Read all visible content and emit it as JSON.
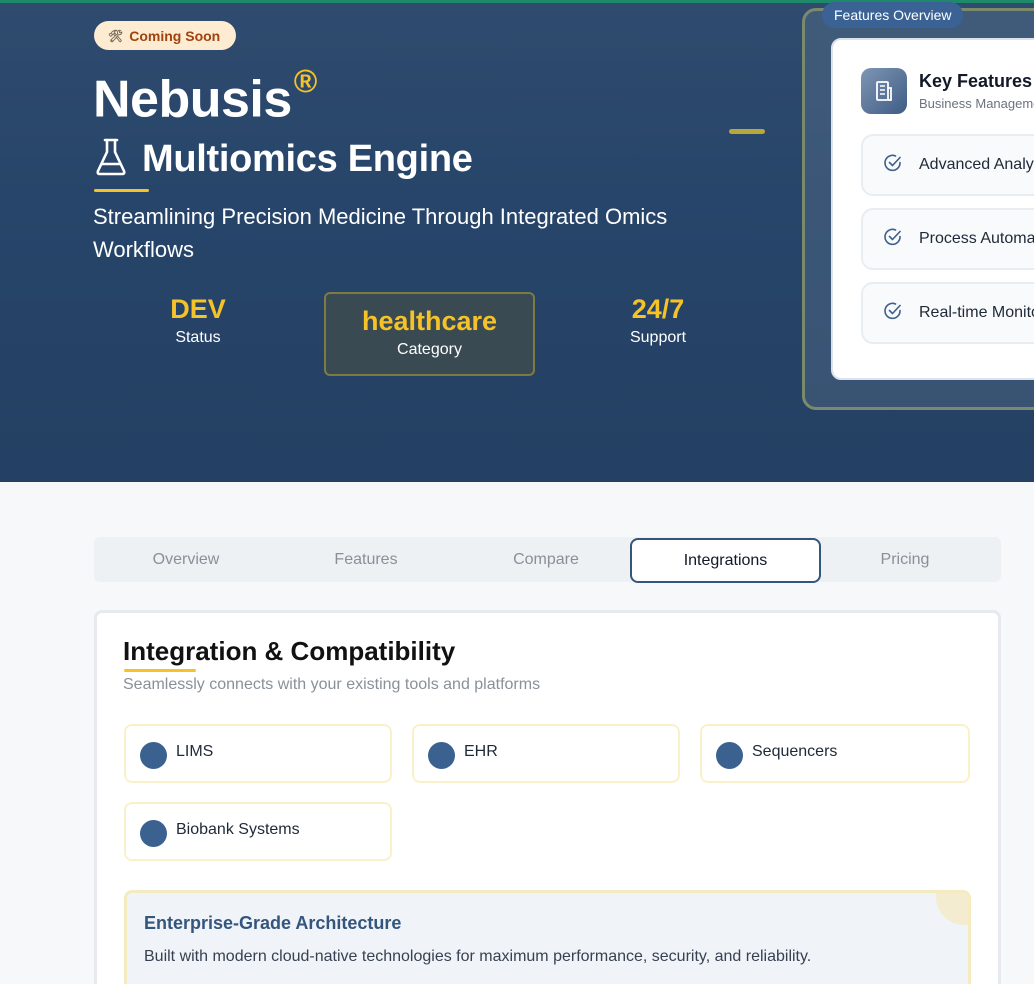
{
  "hero": {
    "badge_icon": "tools-icon",
    "badge": "Coming Soon",
    "title": "Nebusis",
    "title_mark": "®",
    "subtitle_title": "Multiomics Engine",
    "tagline": "Streamlining Precision Medicine Through Integrated Omics Workflows",
    "stats": {
      "status": {
        "value": "DEV",
        "label": "Status"
      },
      "category": {
        "value": "healthcare",
        "label": "Category"
      },
      "support": {
        "value": "24/7",
        "label": "Support"
      }
    }
  },
  "features_overview": {
    "tag": "Features Overview",
    "title": "Key Features",
    "subtitle": "Business Management",
    "items": [
      {
        "label": "Advanced Analytics"
      },
      {
        "label": "Process Automation"
      },
      {
        "label": "Real-time Monitoring"
      }
    ]
  },
  "tabs": [
    {
      "label": "Overview",
      "active": false
    },
    {
      "label": "Features",
      "active": false
    },
    {
      "label": "Compare",
      "active": false
    },
    {
      "label": "Integrations",
      "active": true
    },
    {
      "label": "Pricing",
      "active": false
    }
  ],
  "integrations": {
    "title": "Integration & Compatibility",
    "subtitle": "Seamlessly connects with your existing tools and platforms",
    "items": [
      {
        "name": "LIMS"
      },
      {
        "name": "EHR"
      },
      {
        "name": "Sequencers"
      },
      {
        "name": "Biobank Systems"
      }
    ],
    "enterprise": {
      "title": "Enterprise-Grade Architecture",
      "description": "Built with modern cloud-native technologies for maximum performance, security, and reliability."
    }
  },
  "colors": {
    "hero_bg": "#2a4769",
    "accent": "#f5c228",
    "primary": "#34557c",
    "badge_bg": "#fdebd2",
    "badge_text": "#a0420f"
  }
}
